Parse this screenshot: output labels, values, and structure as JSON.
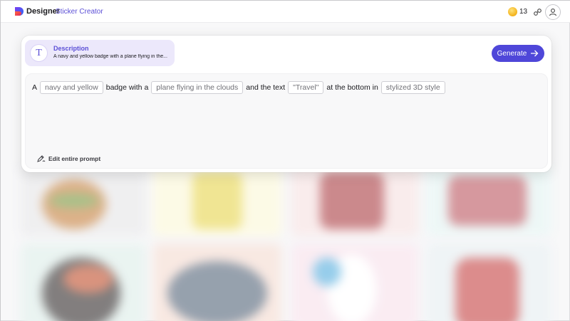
{
  "header": {
    "app_name": "Designer",
    "app_section": "Sticker Creator",
    "coin_count": "13",
    "icons": {
      "logo": "designer-logo",
      "coin": "coin-icon",
      "share": "share-icon",
      "profile": "profile-icon"
    },
    "colors": {
      "accent": "#5b4fd6",
      "coin": "#f3b21a"
    }
  },
  "description": {
    "icon_glyph": "T",
    "title": "Description",
    "text": "A navy and yellow badge with a plane flying in the..."
  },
  "generate": {
    "label": "Generate",
    "icon": "arrow-right-icon",
    "color": "#4f47d9"
  },
  "prompt": {
    "parts": [
      {
        "type": "text",
        "value": "A"
      },
      {
        "type": "chip",
        "value": "navy and yellow"
      },
      {
        "type": "text",
        "value": "badge with a"
      },
      {
        "type": "chip",
        "value": "plane flying in the clouds"
      },
      {
        "type": "text",
        "value": "and the text"
      },
      {
        "type": "chip",
        "value": "\"Travel\""
      },
      {
        "type": "text",
        "value": "at the bottom in"
      },
      {
        "type": "chip",
        "value": "stylized 3D style"
      }
    ],
    "edit_label": "Edit entire prompt",
    "edit_icon": "edit-pen-icon"
  }
}
